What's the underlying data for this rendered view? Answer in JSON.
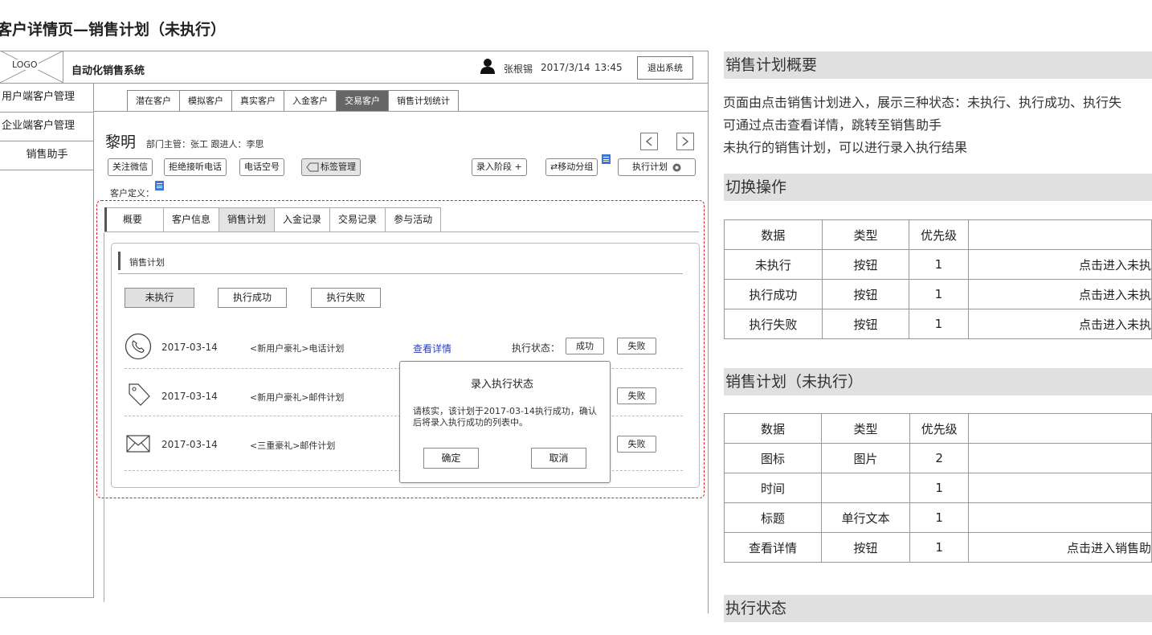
{
  "page_title": "客户详情页—销售计划（未执行）",
  "app": {
    "logo_text": "LOGO",
    "name": "自动化销售系统",
    "user": {
      "name": "张根锡",
      "date": "2017/3/14",
      "time": "13:45"
    },
    "logout_label": "退出系统"
  },
  "sidebar": {
    "items": [
      {
        "label": "用户端客户管理"
      },
      {
        "label": "企业端客户管理"
      },
      {
        "label": "销售助手"
      }
    ]
  },
  "main_tabs": [
    {
      "label": "潜在客户",
      "active": false
    },
    {
      "label": "模拟客户",
      "active": false
    },
    {
      "label": "真实客户",
      "active": false
    },
    {
      "label": "入金客户",
      "active": false
    },
    {
      "label": "交易客户",
      "active": true
    },
    {
      "label": "销售计划统计",
      "active": false
    }
  ],
  "customer": {
    "name": "黎明",
    "meta": "部门主管：张工  跟进人：李思",
    "actions": [
      "关注微信",
      "拒绝接听电话",
      "电话空号",
      "标签管理"
    ],
    "stage_btn": "录入阶段 +",
    "move_group_btn": "⇄移动分组",
    "exec_plan_btn": "执行计划",
    "definition_label": "客户定义："
  },
  "detail_tabs": [
    {
      "label": "概要",
      "active": false
    },
    {
      "label": "客户信息",
      "active": false
    },
    {
      "label": "销售计划",
      "active": true
    },
    {
      "label": "入金记录",
      "active": false
    },
    {
      "label": "交易记录",
      "active": false
    },
    {
      "label": "参与活动",
      "active": false
    }
  ],
  "plan": {
    "title": "销售计划",
    "status_tabs": [
      {
        "label": "未执行",
        "active": true
      },
      {
        "label": "执行成功",
        "active": false
      },
      {
        "label": "执行失败",
        "active": false
      }
    ],
    "rows": [
      {
        "icon": "phone-icon",
        "date": "2017-03-14",
        "title": "<新用户豪礼>电话计划"
      },
      {
        "icon": "tag-icon",
        "date": "2017-03-14",
        "title": "<新用户豪礼>邮件计划"
      },
      {
        "icon": "envelope-icon",
        "date": "2017-03-14",
        "title": "<三重豪礼>邮件计划"
      }
    ],
    "detail_link": "查看详情",
    "exec_status_label": "执行状态：",
    "success_label": "成功",
    "fail_label": "失败"
  },
  "dialog": {
    "title": "录入执行状态",
    "message": "请核实，该计划于2017-03-14执行成功，确认后将录入执行成功的列表中。",
    "confirm": "确定",
    "cancel": "取消"
  },
  "doc": {
    "overview": {
      "heading": "销售计划概要",
      "lines": [
        "页面由点击销售计划进入，展示三种状态：未执行、执行成功、执行失",
        "可通过点击查看详情，跳转至销售助手",
        "未执行的销售计划，可以进行录入执行结果"
      ]
    },
    "switch": {
      "heading": "切换操作",
      "columns": [
        "数据",
        "类型",
        "优先级",
        ""
      ],
      "rows": [
        [
          "未执行",
          "按钮",
          "1",
          "点击进入未执"
        ],
        [
          "执行成功",
          "按钮",
          "1",
          "点击进入未执"
        ],
        [
          "执行失败",
          "按钮",
          "1",
          "点击进入未执"
        ]
      ]
    },
    "plan_table": {
      "heading": "销售计划（未执行）",
      "columns": [
        "数据",
        "类型",
        "优先级",
        ""
      ],
      "rows": [
        [
          "图标",
          "图片",
          "2",
          ""
        ],
        [
          "时间",
          "",
          "1",
          ""
        ],
        [
          "标题",
          "单行文本",
          "1",
          ""
        ],
        [
          "查看详情",
          "按钮",
          "1",
          "点击进入销售助"
        ]
      ]
    },
    "exec_status": {
      "heading": "执行状态"
    }
  },
  "colors": {
    "link": "#2a3fbf",
    "dashed_border": "#e02020",
    "note_icon": "#3a78d6",
    "active_tab": "#666666"
  }
}
